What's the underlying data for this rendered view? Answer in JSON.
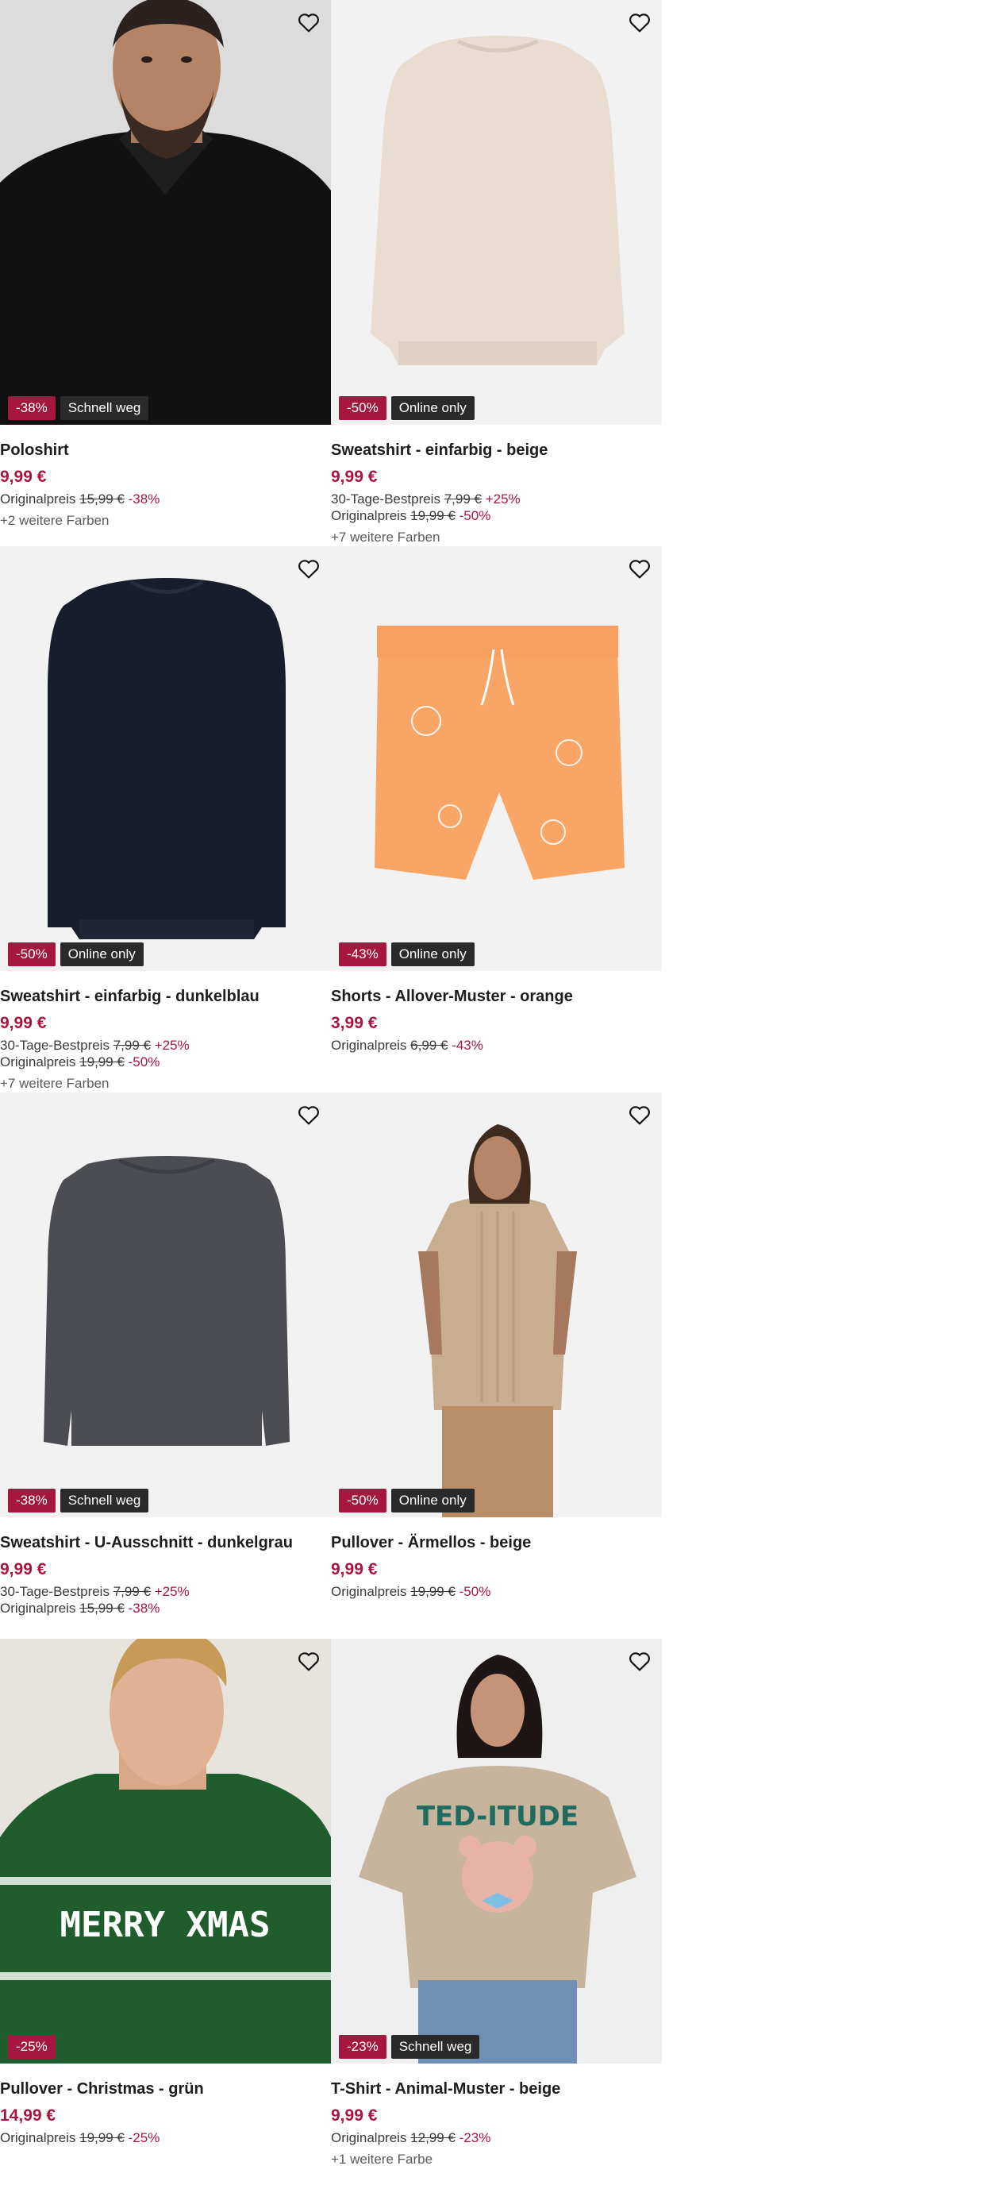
{
  "products": [
    {
      "title": "Poloshirt",
      "price": "9,99 €",
      "badges": [
        {
          "text": "-38%",
          "kind": "sale"
        },
        {
          "text": "Schnell weg",
          "kind": "tag"
        }
      ],
      "best_label": "",
      "best_old": "",
      "best_pct": "",
      "orig_label": "Originalpreis",
      "orig_old": "15,99 €",
      "orig_pct": "-38%",
      "colors": "+2 weitere Farben",
      "image": "man-black-polo-shirt"
    },
    {
      "title": "Sweatshirt - einfarbig - beige",
      "price": "9,99 €",
      "badges": [
        {
          "text": "-50%",
          "kind": "sale"
        },
        {
          "text": "Online only",
          "kind": "tag"
        }
      ],
      "best_label": "30-Tage-Bestpreis",
      "best_old": "7,99 €",
      "best_pct": "+25%",
      "orig_label": "Originalpreis",
      "orig_old": "19,99 €",
      "orig_pct": "-50%",
      "colors": "+7 weitere Farben",
      "image": "beige-sweatshirt"
    },
    {
      "title": "Sweatshirt - einfarbig - dunkelblau",
      "price": "9,99 €",
      "badges": [
        {
          "text": "-50%",
          "kind": "sale"
        },
        {
          "text": "Online only",
          "kind": "tag"
        }
      ],
      "best_label": "30-Tage-Bestpreis",
      "best_old": "7,99 €",
      "best_pct": "+25%",
      "orig_label": "Originalpreis",
      "orig_old": "19,99 €",
      "orig_pct": "-50%",
      "colors": "+7 weitere Farben",
      "image": "navy-sweatshirt"
    },
    {
      "title": "Shorts - Allover-Muster - orange",
      "price": "3,99 €",
      "badges": [
        {
          "text": "-43%",
          "kind": "sale"
        },
        {
          "text": "Online only",
          "kind": "tag"
        }
      ],
      "best_label": "",
      "best_old": "",
      "best_pct": "",
      "orig_label": "Originalpreis",
      "orig_old": "6,99 €",
      "orig_pct": "-43%",
      "colors": "",
      "image": "orange-patterned-shorts"
    },
    {
      "title": "Sweatshirt - U-Ausschnitt - dunkelgrau",
      "price": "9,99 €",
      "badges": [
        {
          "text": "-38%",
          "kind": "sale"
        },
        {
          "text": "Schnell weg",
          "kind": "tag"
        }
      ],
      "best_label": "30-Tage-Bestpreis",
      "best_old": "7,99 €",
      "best_pct": "+25%",
      "orig_label": "Originalpreis",
      "orig_old": "15,99 €",
      "orig_pct": "-38%",
      "colors": "",
      "image": "dark-grey-sweatshirt"
    },
    {
      "title": "Pullover - Ärmellos - beige",
      "price": "9,99 €",
      "badges": [
        {
          "text": "-50%",
          "kind": "sale"
        },
        {
          "text": "Online only",
          "kind": "tag"
        }
      ],
      "best_label": "",
      "best_old": "",
      "best_pct": "",
      "orig_label": "Originalpreis",
      "orig_old": "19,99 €",
      "orig_pct": "-50%",
      "colors": "",
      "image": "woman-sleeveless-knit"
    },
    {
      "title": "Pullover - Christmas - grün",
      "price": "14,99 €",
      "badges": [
        {
          "text": "-25%",
          "kind": "sale"
        }
      ],
      "best_label": "",
      "best_old": "",
      "best_pct": "",
      "orig_label": "Originalpreis",
      "orig_old": "19,99 €",
      "orig_pct": "-25%",
      "colors": "",
      "image": "man-christmas-sweater",
      "print_text": "MERRY XMAS"
    },
    {
      "title": "T-Shirt - Animal-Muster - beige",
      "price": "9,99 €",
      "badges": [
        {
          "text": "-23%",
          "kind": "sale"
        },
        {
          "text": "Schnell weg",
          "kind": "tag"
        }
      ],
      "best_label": "",
      "best_old": "",
      "best_pct": "",
      "orig_label": "Originalpreis",
      "orig_old": "12,99 €",
      "orig_pct": "-23%",
      "colors": "+1 weitere Farbe",
      "image": "woman-teddy-tshirt",
      "print_text": "TED-ITUDE"
    }
  ],
  "colors": {
    "sale_red": "#a5173f",
    "tag_dark": "#2a2a2a",
    "image_bg": "#f2f2f2"
  },
  "icons": {
    "wishlist": "heart-outline-icon"
  }
}
